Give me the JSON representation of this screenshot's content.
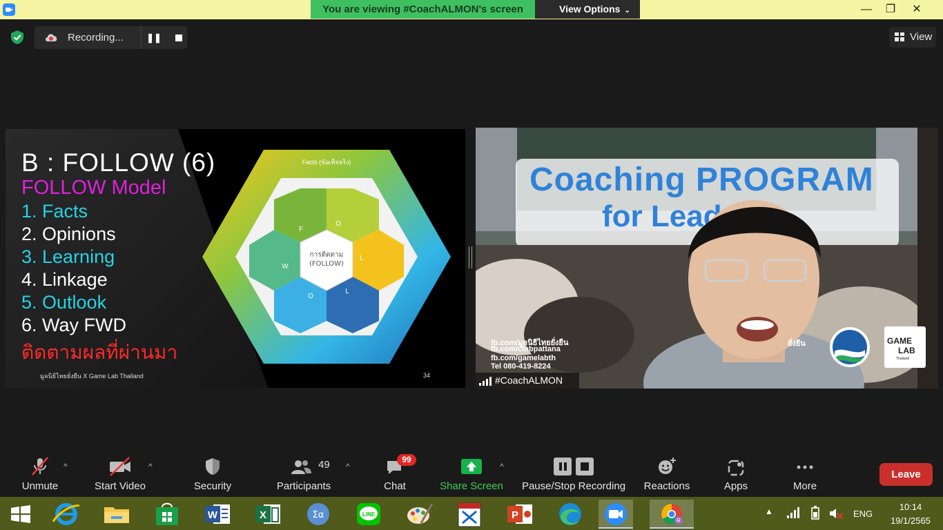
{
  "window": {
    "banner": "You are viewing #CoachALMON's screen",
    "view_options": "View Options",
    "min_glyph": "—",
    "max_glyph": "❐",
    "close_glyph": "✕"
  },
  "top_bar": {
    "recording_label": "Recording...",
    "view_label": "View"
  },
  "slide": {
    "title": "B : FOLLOW (6)",
    "subtitle": "FOLLOW Model",
    "items": [
      "1.  Facts",
      "2. Opinions",
      "3. Learning",
      "4. Linkage",
      "5. Outlook",
      "6. Way FWD"
    ],
    "thai_line": "ติดตามผลที่ผ่านมา",
    "footer": "มูลนิธิไทยยั่งยืน X Game Lab Thailand",
    "page_number": "34",
    "diagram": {
      "center_thai": "การติดตาม",
      "center_en": "(FOLLOW)",
      "outer_top": "Facts (ข้อเท็จจริง)",
      "letters": [
        "F",
        "O",
        "L",
        "L",
        "O",
        "W"
      ]
    }
  },
  "video": {
    "title_line1": "Coaching PROGRAM",
    "title_line2": "for Leader",
    "fb_lines": [
      "fb.com/มูลนิธิไทยยั่งยืน",
      "fb.com/clubpattana",
      "fb.com/gamelabth",
      "Tel 080-419-8224"
    ],
    "partner_text": "ยั่งยืน",
    "gamelab_line1": "GAME",
    "gamelab_line2": "LAB",
    "gamelab_line3": "Thailand",
    "participant_name": "#CoachALMON"
  },
  "toolbar": {
    "unmute": "Unmute",
    "start_video": "Start Video",
    "security": "Security",
    "participants": "Participants",
    "participant_count": "49",
    "chat": "Chat",
    "chat_badge": "99",
    "share_screen": "Share Screen",
    "pause_stop_recording": "Pause/Stop Recording",
    "reactions": "Reactions",
    "apps": "Apps",
    "more": "More",
    "leave": "Leave"
  },
  "taskbar": {
    "language": "ENG",
    "time": "10:14",
    "date": "19/1/2565",
    "apps": [
      "start-icon",
      "internet-explorer-icon",
      "file-explorer-icon",
      "store-icon",
      "word-icon",
      "excel-icon",
      "math-input-icon",
      "line-icon",
      "paint-icon",
      "lisrel-icon",
      "powerpoint-icon",
      "edge-icon",
      "zoom-icon",
      "chrome-icon"
    ]
  },
  "colors": {
    "banner_green": "#3fc060",
    "leave_red": "#c9302c",
    "share_green": "#17b34a",
    "slide_cyan": "#25d3e6",
    "slide_magenta": "#e020e0",
    "slide_red": "#ff2a2a"
  }
}
